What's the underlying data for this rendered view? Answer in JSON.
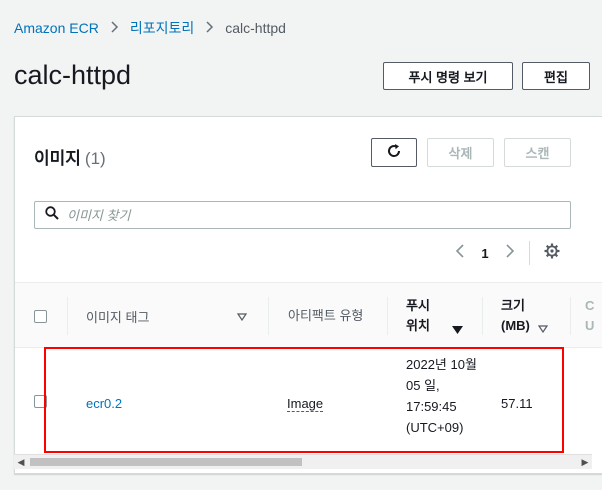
{
  "breadcrumb": {
    "items": [
      "Amazon ECR",
      "리포지토리",
      "calc-httpd"
    ]
  },
  "page": {
    "title": "calc-httpd",
    "push_commands_button": "푸시 명령 보기",
    "edit_button": "편집"
  },
  "images_panel": {
    "title": "이미지",
    "count": "(1)",
    "delete_button": "삭제",
    "scan_button": "스캔",
    "search_placeholder": "이미지 찾기",
    "current_page": "1"
  },
  "table": {
    "headers": {
      "image_tag": "이미지 태그",
      "artifact_type": "아티팩트 유형",
      "pushed_at": "푸시 위치",
      "size": "크기 (MB)",
      "next_partial": "C U"
    },
    "rows": [
      {
        "image_tag": "ecr0.2",
        "artifact_type": "Image",
        "pushed_at": "2022년 10월 05 일, 17:59:45 (UTC+09)",
        "size": "57.11"
      }
    ]
  },
  "colors": {
    "link": "#0073bb",
    "highlight": "#ff0000",
    "border": "#545b64",
    "disabled": "#aab7b8"
  },
  "icons": [
    "chevron-right-icon",
    "refresh-icon",
    "search-icon",
    "chevron-left-icon",
    "gear-icon",
    "sort-down-icon",
    "sort-icon"
  ]
}
